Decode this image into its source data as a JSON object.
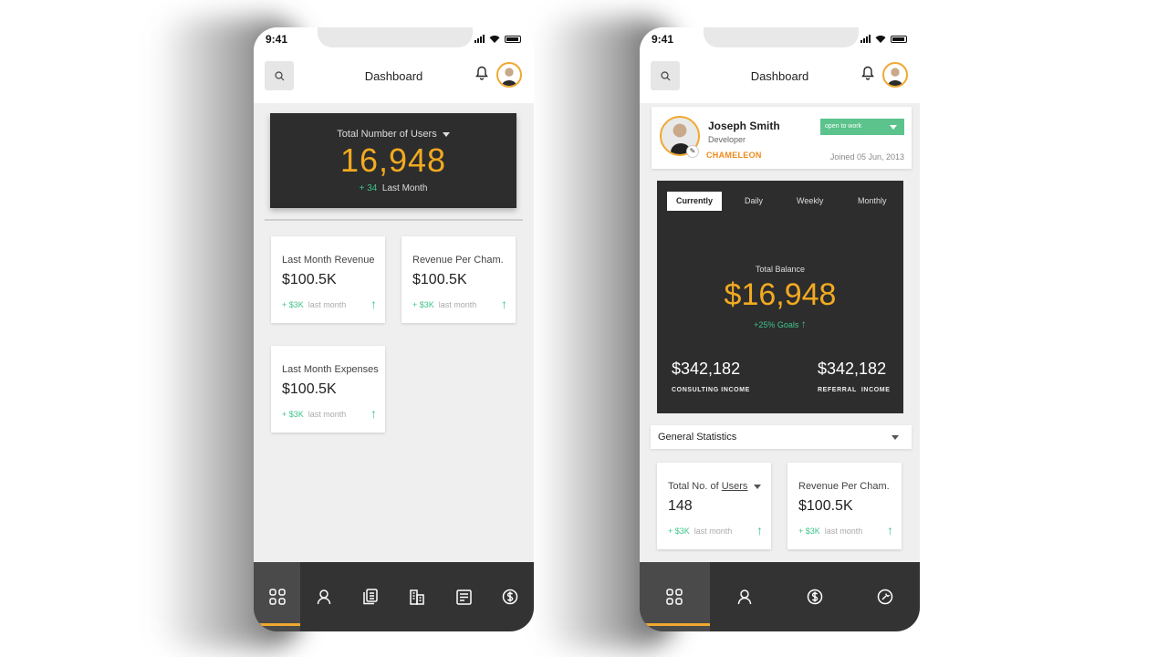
{
  "colors": {
    "accent": "#f2aa20",
    "positive": "#3fc48a",
    "card_dark": "#2d2d2d",
    "tag_green": "#5cc38c"
  },
  "left_phone": {
    "status": {
      "time": "9:41"
    },
    "header": {
      "title": "Dashboard",
      "search_icon": "search-icon",
      "bell_icon": "bell-icon"
    },
    "users_card": {
      "label": "Total Number of Users",
      "value": "16,948",
      "delta": "+ 34",
      "delta_label": "Last Month"
    },
    "stats": [
      {
        "label": "Last Month Revenue",
        "value": "$100.5K",
        "delta": "+ $3K",
        "delta_label": "last month"
      },
      {
        "label": "Revenue Per Cham.",
        "value": "$100.5K",
        "delta": "+ $3K",
        "delta_label": "last month"
      },
      {
        "label": "Last Month Expenses",
        "value": "$100.5K",
        "delta": "+ $3K",
        "delta_label": "last month"
      }
    ],
    "tabbar": [
      "grid-icon",
      "user-icon",
      "documents-icon",
      "buildings-icon",
      "notes-icon",
      "dollar-icon"
    ]
  },
  "right_phone": {
    "status": {
      "time": "9:41"
    },
    "header": {
      "title": "Dashboard"
    },
    "profile": {
      "name": "Joseph Smith",
      "role": "Developer",
      "company": "CHAMELEON",
      "availability": "open to work",
      "joined": "Joined 05 Jun, 2013"
    },
    "balance": {
      "tabs": [
        "Currently",
        "Daily",
        "Weekly",
        "Monthly"
      ],
      "active_tab": "Currently",
      "label": "Total Balance",
      "value": "$16,948",
      "goal": "+25% Goals",
      "consulting": {
        "value": "$342,182",
        "label": "CONSULTING INCOME"
      },
      "referral": {
        "value": "$342,182",
        "label": "REFERRAL  INCOME"
      }
    },
    "general_stats": {
      "title": "General Statistics",
      "cards": [
        {
          "label_prefix": "Total No. of ",
          "label_link": "Users",
          "value": "148",
          "delta": "+ $3K",
          "delta_label": "last month"
        },
        {
          "label": "Revenue Per Cham.",
          "value": "$100.5K",
          "delta": "+ $3K",
          "delta_label": "last month"
        }
      ]
    },
    "tabbar": [
      "grid-icon",
      "user-icon",
      "dollar-icon",
      "tools-icon"
    ]
  }
}
